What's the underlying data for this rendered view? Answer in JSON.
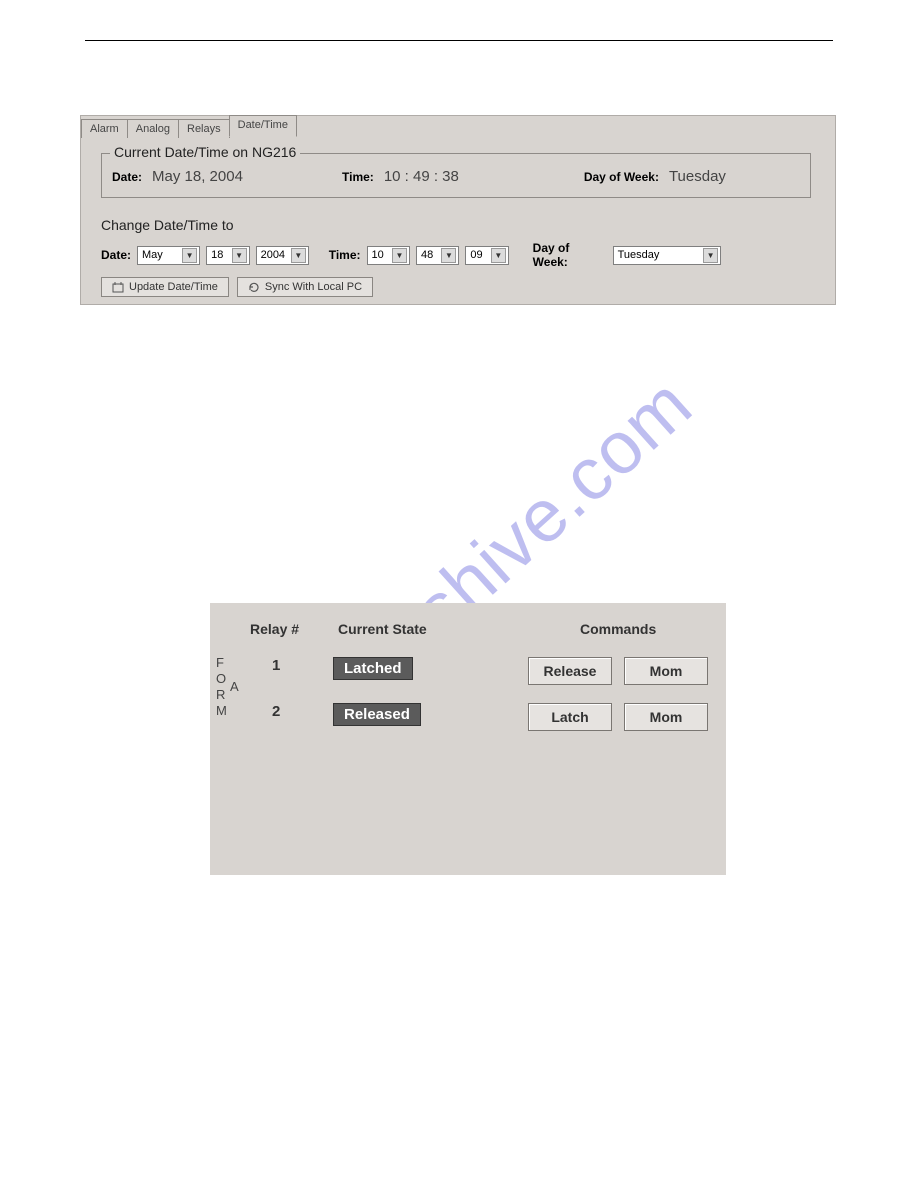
{
  "watermark": "manualshive.com",
  "tabs": {
    "alarm": "Alarm",
    "analog": "Analog",
    "relays": "Relays",
    "datetime": "Date/Time"
  },
  "current": {
    "group_title": "Current Date/Time on NG216",
    "date_label": "Date:",
    "date_value": "May 18, 2004",
    "time_label": "Time:",
    "time_value": "10 : 49 : 38",
    "dow_label": "Day of Week:",
    "dow_value": "Tuesday"
  },
  "change": {
    "group_title": "Change Date/Time to",
    "date_label": "Date:",
    "month": "May",
    "day": "18",
    "year": "2004",
    "time_label": "Time:",
    "hour": "10",
    "minute": "48",
    "second": "09",
    "dow_label": "Day of Week:",
    "dow_value": "Tuesday",
    "btn_update": "Update Date/Time",
    "btn_sync": "Sync With Local PC"
  },
  "relays": {
    "hdr_relay": "Relay #",
    "hdr_state": "Current State",
    "hdr_cmds": "Commands",
    "form_letters": [
      "F",
      "O",
      "R",
      "M"
    ],
    "form_label": "A",
    "rows": [
      {
        "num": "1",
        "state": "Latched",
        "btn1": "Release",
        "btn2": "Mom"
      },
      {
        "num": "2",
        "state": "Released",
        "btn1": "Latch",
        "btn2": "Mom"
      }
    ]
  }
}
